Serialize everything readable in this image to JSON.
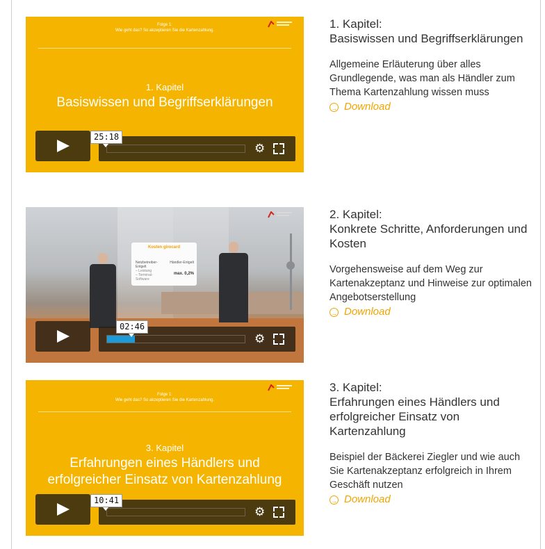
{
  "chapters": [
    {
      "slide_top": "Folge 1:\nWie geht das? So akzeptieren Sie die Kartenzahlung.",
      "slide_chapter": "1. Kapitel",
      "slide_title": "Basiswissen und Begriffserklärungen",
      "time": "25:18",
      "progress": 0,
      "title_line1": "1. Kapitel:",
      "title_line2": "Basiswissen und Begriffserklärungen",
      "description": "Allgemeine Erläuterung über alles Grundlegende, was man als Händler zum Thema Kartenzahlung wissen muss",
      "download": "Download"
    },
    {
      "slide_board_title": "Kosten girocard",
      "slide_board_left": "Netzbetreiber-Entgelt",
      "slide_board_left_sub": "– Leistung\n– Terminal-Software",
      "slide_board_right": "Händler-Entgelt",
      "slide_board_value": "max. 0,2%",
      "time": "02:46",
      "progress": 0.2,
      "title_line1": "2. Kapitel:",
      "title_line2": "Konkrete Schritte, Anforderungen und Kosten",
      "description": "Vorgehensweise auf dem Weg zur Kartenakzeptanz und Hinweise zur optimalen Angebotserstellung",
      "download": "Download"
    },
    {
      "slide_top": "Folge 1:\nWie geht das? So akzeptieren Sie die Kartenzahlung.",
      "slide_chapter": "3. Kapitel",
      "slide_title": "Erfahrungen eines Händlers und erfolgreicher Einsatz von Kartenzahlung",
      "time": "10:41",
      "progress": 0,
      "title_line1": "3. Kapitel:",
      "title_line2": "Erfahrungen eines Händlers und erfolgreicher Einsatz von Kartenzahlung",
      "description": "Beispiel der Bäckerei Ziegler und wie auch Sie Kartenakzeptanz erfolgreich in Ihrem Geschäft nutzen",
      "download": "Download"
    }
  ],
  "colors": {
    "slide_yellow": "#f4b400",
    "accent_orange": "#f0a500",
    "progress_blue": "#1f9ad9"
  },
  "icons": [
    "play-icon",
    "gear-icon",
    "fullscreen-icon",
    "download-arrow-icon",
    "logo-icon"
  ]
}
